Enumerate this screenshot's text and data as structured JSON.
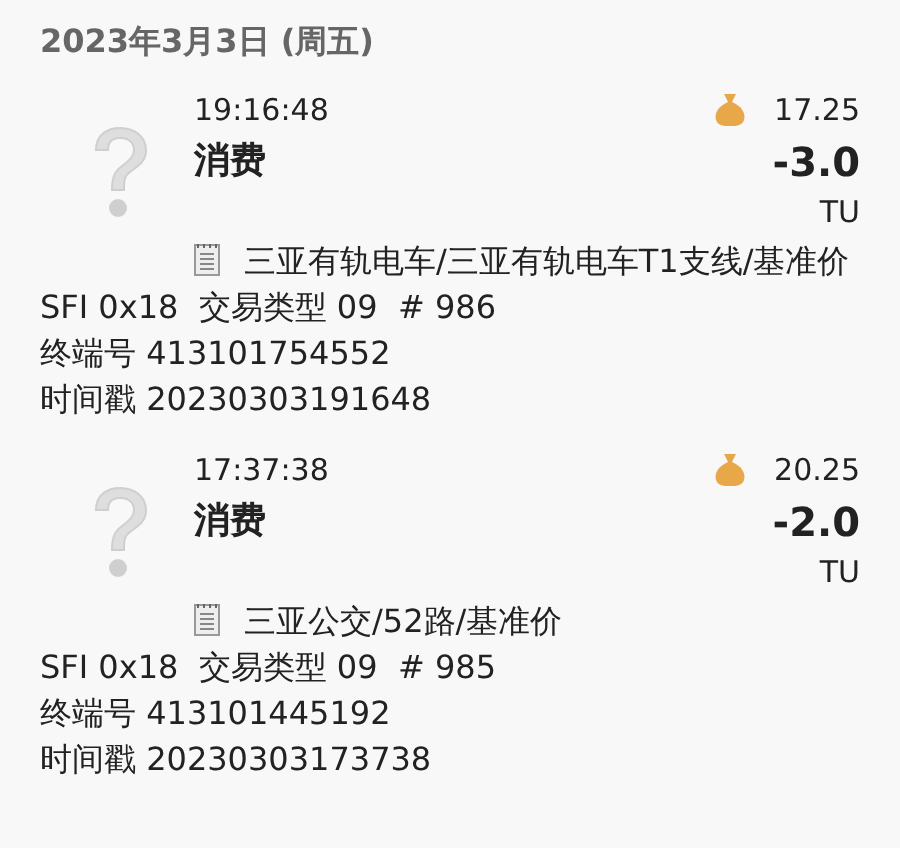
{
  "date": "2023年3月3日 (周五)",
  "entries": [
    {
      "time": "19:16:48",
      "balance": "17.25",
      "type": "消费",
      "amount": "-3.0",
      "unit": "TU",
      "memo": "三亚有轨电车/三亚有轨电车T1支线/基准价",
      "record": "SFI 0x18  交易类型 09  # 986",
      "terminal": "终端号 413101754552",
      "timestamp": "时间戳 20230303191648"
    },
    {
      "time": "17:37:38",
      "balance": "20.25",
      "type": "消费",
      "amount": "-2.0",
      "unit": "TU",
      "memo": "三亚公交/52路/基准价",
      "record": "SFI 0x18  交易类型 09  # 985",
      "terminal": "终端号 413101445192",
      "timestamp": "时间戳 20230303173738"
    }
  ]
}
